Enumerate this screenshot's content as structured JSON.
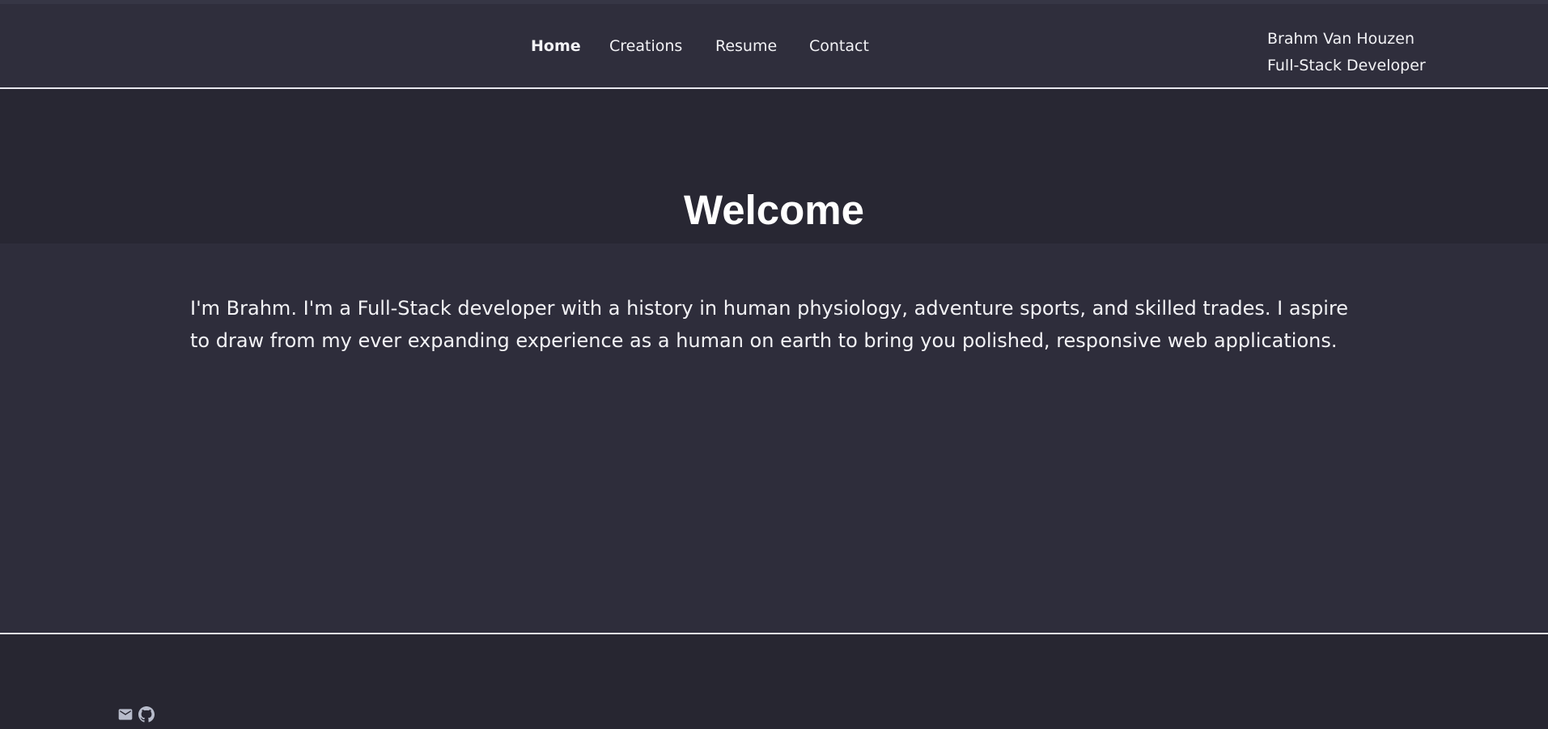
{
  "nav": {
    "items": [
      {
        "label": "Home",
        "active": true
      },
      {
        "label": "Creations",
        "active": false
      },
      {
        "label": "Resume",
        "active": false
      },
      {
        "label": "Contact",
        "active": false
      }
    ]
  },
  "identity": {
    "name": "Brahm Van Houzen",
    "role": "Full-Stack Developer"
  },
  "hero": {
    "title": "Welcome"
  },
  "intro": {
    "text": "I'm Brahm. I'm a Full-Stack developer with a history in human physiology, adventure sports, and skilled trades. I aspire to draw from my ever expanding experience as a human on earth to bring you polished, responsive web applications."
  },
  "footer": {
    "icons": [
      "mail-icon",
      "github-icon"
    ]
  },
  "colors": {
    "header_bg": "#2f2e3c",
    "hero_bg": "#282733",
    "body_bg": "#2e2d3b",
    "footer_bg": "#272631",
    "divider": "#e8e8ee",
    "icon": "#b8bccb"
  }
}
